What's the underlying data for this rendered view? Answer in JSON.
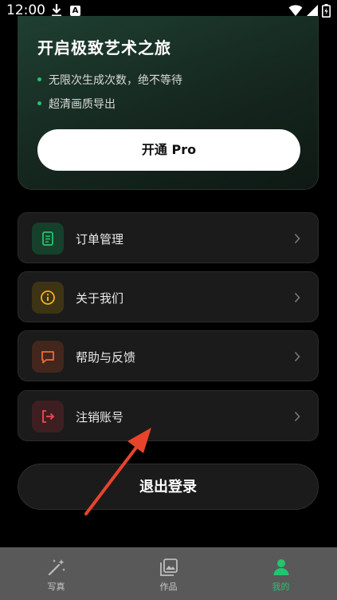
{
  "status_bar": {
    "time": "12:00",
    "notification_letter": "A"
  },
  "pro_card": {
    "title": "开启极致艺术之旅",
    "benefits": [
      "无限次生成次数，绝不等待",
      "超清画质导出"
    ],
    "button_label": "开通 Pro"
  },
  "menu": {
    "items": [
      {
        "label": "订单管理",
        "icon": "receipt-icon",
        "color": "#22c46e"
      },
      {
        "label": "关于我们",
        "icon": "info-icon",
        "color": "#f1b11d"
      },
      {
        "label": "帮助与反馈",
        "icon": "chat-icon",
        "color": "#f06a3c"
      },
      {
        "label": "注销账号",
        "icon": "logout-icon",
        "color": "#ef4a52"
      }
    ]
  },
  "logout_button": {
    "label": "退出登录"
  },
  "bottom_nav": {
    "tabs": [
      {
        "label": "写真",
        "icon": "magic-wand-icon",
        "active": false
      },
      {
        "label": "作品",
        "icon": "gallery-icon",
        "active": false
      },
      {
        "label": "我的",
        "icon": "profile-icon",
        "active": true
      }
    ]
  },
  "colors": {
    "accent": "#22c46e",
    "annotation_arrow": "#e8442c"
  }
}
